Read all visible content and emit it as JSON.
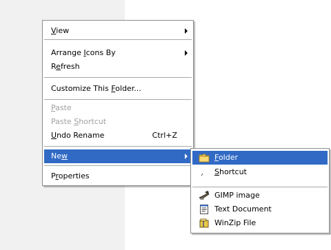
{
  "context_menu": {
    "items": [
      {
        "name": "menu-item-view",
        "label": "View",
        "underline_index": 0,
        "submenu": true,
        "state": "normal"
      },
      {
        "name": "menu-item-arrange-icons-by",
        "label": "Arrange Icons By",
        "underline_index": 8,
        "submenu": true,
        "state": "normal"
      },
      {
        "name": "menu-item-refresh",
        "label": "Refresh",
        "underline_index": 1,
        "state": "normal"
      },
      {
        "name": "menu-item-customize-this-folder",
        "label": "Customize This Folder...",
        "underline_index": 15,
        "state": "normal"
      },
      {
        "name": "menu-item-paste",
        "label": "Paste",
        "underline_index": 0,
        "state": "disabled"
      },
      {
        "name": "menu-item-paste-shortcut",
        "label": "Paste Shortcut",
        "underline_index": 6,
        "state": "disabled"
      },
      {
        "name": "menu-item-undo-rename",
        "label": "Undo Rename",
        "underline_index": 0,
        "shortcut": "Ctrl+Z",
        "state": "normal"
      },
      {
        "name": "menu-item-new",
        "label": "New",
        "underline_index": 2,
        "submenu": true,
        "state": "selected"
      },
      {
        "name": "menu-item-properties",
        "label": "Properties",
        "underline_index": 1,
        "state": "normal"
      }
    ]
  },
  "new_submenu": {
    "items": [
      {
        "name": "submenu-item-folder",
        "label": "Folder",
        "underline_index": 0,
        "icon": "folder-icon",
        "state": "selected"
      },
      {
        "name": "submenu-item-shortcut",
        "label": "Shortcut",
        "underline_index": 0,
        "icon": "shortcut-icon",
        "state": "normal"
      },
      {
        "name": "submenu-item-gimp-image",
        "label": "GIMP image",
        "icon": "gimp-image-icon",
        "state": "normal"
      },
      {
        "name": "submenu-item-text-document",
        "label": "Text Document",
        "icon": "text-document-icon",
        "state": "normal"
      },
      {
        "name": "submenu-item-winzip-file",
        "label": "WinZip File",
        "icon": "winzip-file-icon",
        "state": "normal"
      }
    ]
  },
  "colors": {
    "selection": "#316ac5",
    "menu_background": "#ffffff",
    "menu_border": "#8d8d8d",
    "disabled_text": "#a0a0a0",
    "desktop_panel": "#f1f1f1"
  }
}
